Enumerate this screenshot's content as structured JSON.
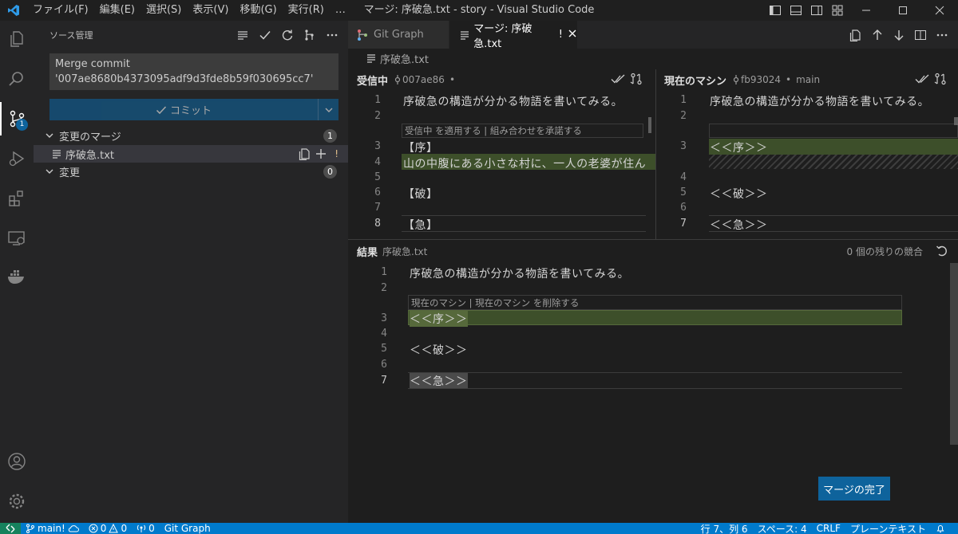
{
  "window": {
    "title": "マージ: 序破急.txt - story - Visual Studio Code",
    "menu": [
      "ファイル(F)",
      "編集(E)",
      "選択(S)",
      "表示(V)",
      "移動(G)",
      "実行(R)",
      "…"
    ]
  },
  "activity_bar": {
    "items": [
      "explorer-icon",
      "search-icon",
      "source-control-icon",
      "run-debug-icon",
      "extensions-icon",
      "remote-explorer-icon",
      "docker-icon"
    ],
    "scm_badge": "1",
    "bottom": [
      "account-icon",
      "settings-gear-icon"
    ]
  },
  "sidebar": {
    "title": "ソース管理",
    "commit_message_line1": "Merge commit",
    "commit_message_line2": "'007ae8680b4373095adf9d3fde8b59f030695cc7'",
    "commit_button": "コミット",
    "merge_changes": {
      "label": "変更のマージ",
      "count": "1"
    },
    "merge_file": {
      "name": "序破急.txt",
      "status": "!"
    },
    "changes": {
      "label": "変更",
      "count": "0"
    }
  },
  "tabs": [
    {
      "label": "Git Graph",
      "active": false
    },
    {
      "label": "マージ: 序破急.txt",
      "status": "!",
      "active": true
    }
  ],
  "breadcrumb": "序破急.txt",
  "incoming": {
    "title": "受信中",
    "commit": "007ae86",
    "dot": "•",
    "codelens": "受信中 を適用する | 組み合わせを承諾する",
    "lines": [
      {
        "n": "1",
        "text": "序破急の構造が分かる物語を書いてみる。"
      },
      {
        "n": "2",
        "text": ""
      },
      {
        "n": "3",
        "text": "【序】"
      },
      {
        "n": "4",
        "text": "山の中腹にある小さな村に、一人の老婆が住ん"
      },
      {
        "n": "5",
        "text": ""
      },
      {
        "n": "6",
        "text": "【破】"
      },
      {
        "n": "7",
        "text": ""
      },
      {
        "n": "8",
        "text": "【急】"
      }
    ]
  },
  "current": {
    "title": "現在のマシン",
    "commit": "fb93024",
    "dot": "•",
    "branch": "main",
    "lines": [
      {
        "n": "1",
        "text": "序破急の構造が分かる物語を書いてみる。"
      },
      {
        "n": "2",
        "text": ""
      },
      {
        "n": "3",
        "text": "＜＜序＞＞"
      },
      {
        "n": "4",
        "text": ""
      },
      {
        "n": "5",
        "text": "＜＜破＞＞"
      },
      {
        "n": "6",
        "text": ""
      },
      {
        "n": "7",
        "text": "＜＜急＞＞"
      }
    ]
  },
  "result": {
    "title": "結果",
    "file": "序破急.txt",
    "remaining": "0 個の残りの競合",
    "codelens": "現在のマシン | 現在のマシン を削除する",
    "lines": [
      {
        "n": "1",
        "text": "序破急の構造が分かる物語を書いてみる。"
      },
      {
        "n": "2",
        "text": ""
      },
      {
        "n": "3",
        "text": "＜＜序＞＞"
      },
      {
        "n": "4",
        "text": ""
      },
      {
        "n": "5",
        "text": "＜＜破＞＞"
      },
      {
        "n": "6",
        "text": ""
      },
      {
        "n": "7",
        "text": "＜＜急＞＞"
      }
    ],
    "complete_button": "マージの完了"
  },
  "status_bar": {
    "branch": "main!",
    "errors": "0",
    "warnings": "0",
    "ports": "0",
    "git_graph": "Git Graph",
    "position": "行 7、列 6",
    "spaces": "スペース: 4",
    "eol": "CRLF",
    "language": "プレーンテキスト"
  },
  "colors": {
    "accent": "#007acc",
    "conflict_green": "#3d4f2a",
    "editor_bg": "#1e1e1e"
  }
}
